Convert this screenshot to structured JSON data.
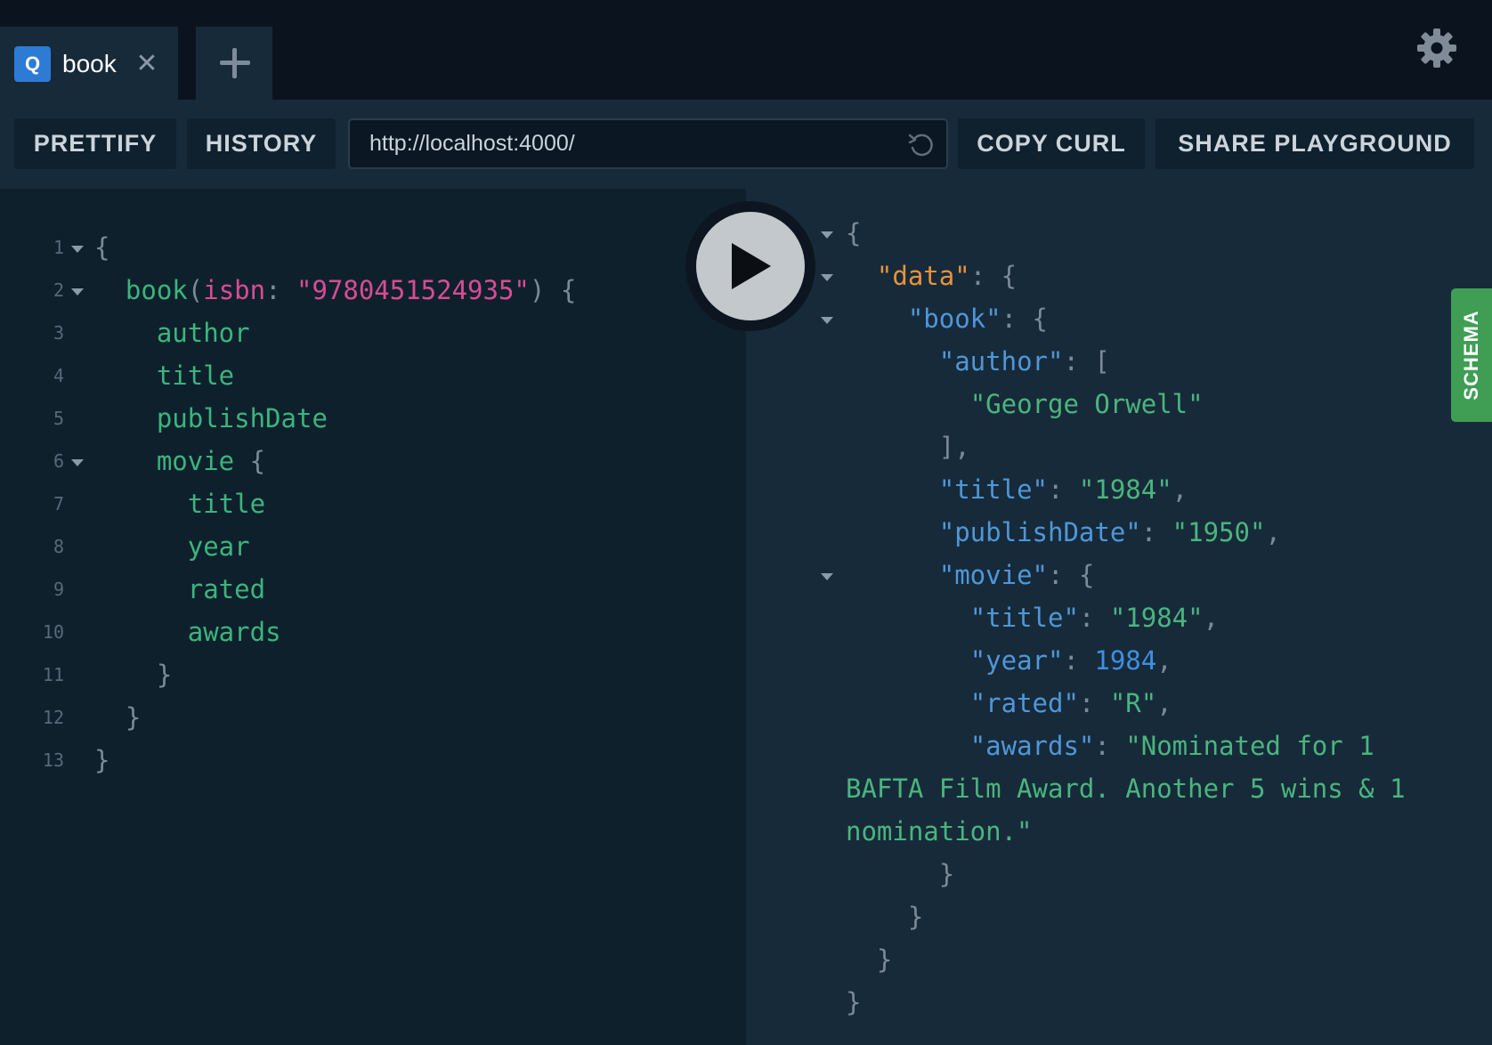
{
  "tabs": [
    {
      "badge": "Q",
      "title": "book"
    }
  ],
  "toolbar": {
    "prettify": "PRETTIFY",
    "history": "HISTORY",
    "endpoint": "http://localhost:4000/",
    "copy_curl": "COPY CURL",
    "share": "SHARE PLAYGROUND"
  },
  "schema_label": "SCHEMA",
  "line_numbers": [
    "1",
    "2",
    "3",
    "4",
    "5",
    "6",
    "7",
    "8",
    "9",
    "10",
    "11",
    "12",
    "13"
  ],
  "query": {
    "field_book": "book",
    "arg_name": "isbn",
    "arg_value": "\"9780451524935\"",
    "fields": [
      "author",
      "title",
      "publishDate"
    ],
    "field_movie": "movie",
    "movie_fields": [
      "title",
      "year",
      "rated",
      "awards"
    ]
  },
  "result": {
    "data_key": "\"data\"",
    "book_key": "\"book\"",
    "author_key": "\"author\"",
    "author_value": "\"George Orwell\"",
    "title_key": "\"title\"",
    "title_value": "\"1984\"",
    "publish_key": "\"publishDate\"",
    "publish_value": "\"1950\"",
    "movie_key": "\"movie\"",
    "movie_title_key": "\"title\"",
    "movie_title_value": "\"1984\"",
    "year_key": "\"year\"",
    "year_value": "1984",
    "rated_key": "\"rated\"",
    "rated_value": "\"R\"",
    "awards_key": "\"awards\"",
    "awards_value_line1": "\"Nominated for 1",
    "awards_value_line2": "BAFTA Film Award. Another 5 wins & 1",
    "awards_value_line3": "nomination.\""
  },
  "colors": {
    "accent": "#2e7bd6",
    "schema_tab": "#3f9e54",
    "field": "#3bb57b",
    "argument": "#d74c95",
    "string": "#4ab57d",
    "key": "#4f97d8",
    "data_key": "#e8923b",
    "number": "#3f8fe0"
  },
  "icons": [
    "close-icon",
    "plus-icon",
    "gear-icon",
    "reload-icon",
    "play-icon",
    "fold-arrow-icon"
  ]
}
